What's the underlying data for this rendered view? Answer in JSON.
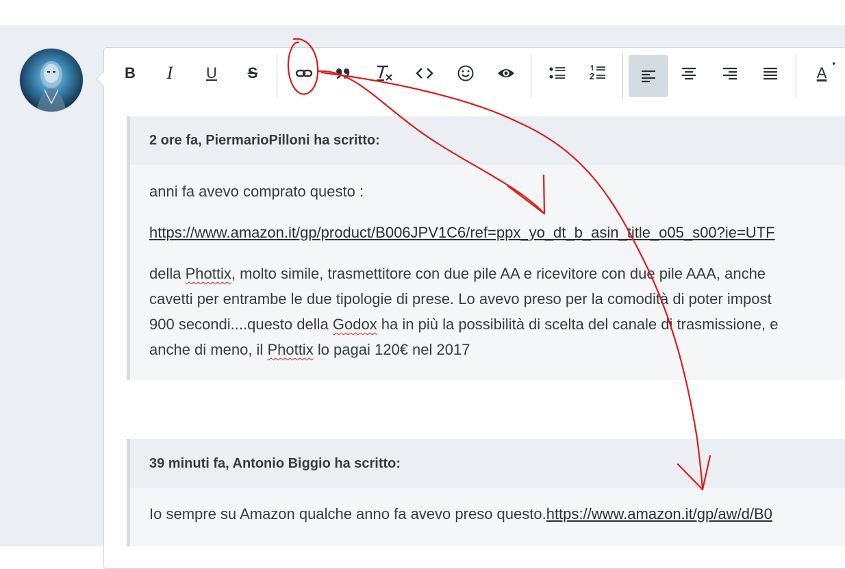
{
  "toolbar": {
    "bold": "B",
    "italic": "I",
    "underline": "U",
    "strike": "S",
    "font_color": "A"
  },
  "quote1": {
    "header": "2 ore fa, PiermarioPilloni ha scritto:",
    "line1": "anni fa avevo comprato questo :",
    "link": "https://www.amazon.it/gp/product/B006JPV1C6/ref=ppx_yo_dt_b_asin_title_o05_s00?ie=UTF",
    "p3a": "della ",
    "p3b": "Phottix",
    "p3c": ", molto simile, trasmettitore con due pile AA e ricevitore con due pile AAA, anche",
    "p4": "cavetti per entrambe le due tipologie di prese. Lo avevo preso per la comodità di poter impost",
    "p5a": "900 secondi....questo della ",
    "p5b": "Godox",
    "p5c": " ha in più la possibilità di scelta del canale di trasmissione, e",
    "p6a": "anche di meno, il ",
    "p6b": "Phottix",
    "p6c": " lo pagai 120€ nel 2017"
  },
  "quote2": {
    "header": "39 minuti fa, Antonio Biggio ha scritto:",
    "line1": "Io sempre su Amazon qualche anno fa avevo preso questo.",
    "link": "https://www.amazon.it/gp/aw/d/B0"
  },
  "colors": {
    "annotation": "#e01b1b",
    "page_bg": "#ebeff3",
    "active_button": "#d6dbe0"
  }
}
